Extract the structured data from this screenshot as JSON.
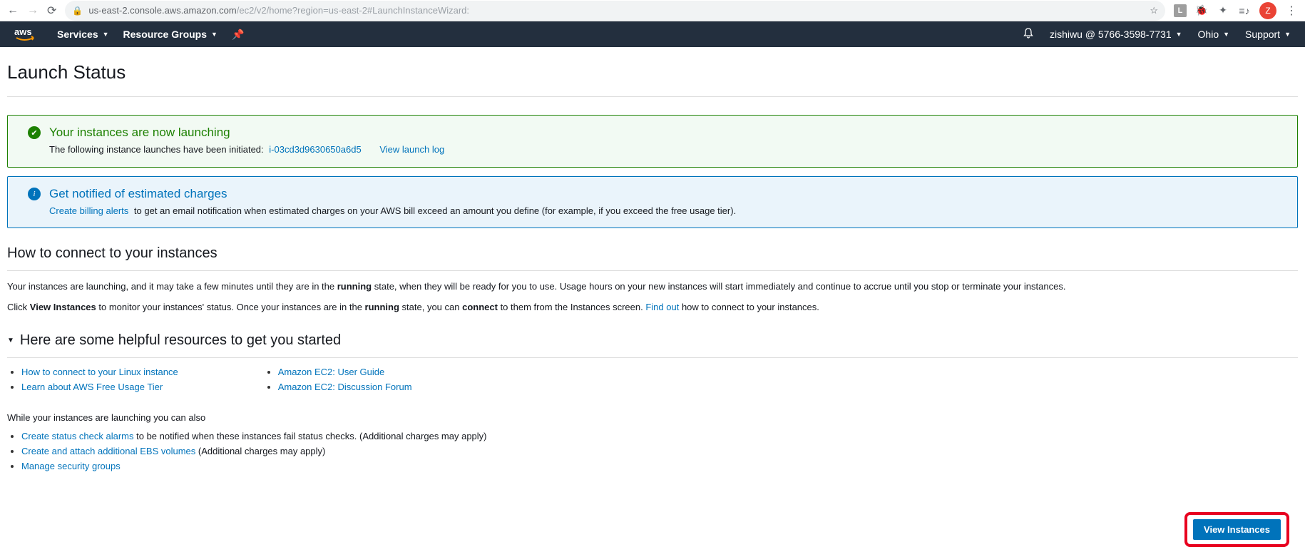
{
  "browser": {
    "url_host": "us-east-2.console.aws.amazon.com",
    "url_path": "/ec2/v2/home?region=us-east-2#LaunchInstanceWizard:",
    "avatar_letter": "Z",
    "ext_l": "L"
  },
  "header": {
    "logo_text": "aws",
    "menu_services": "Services",
    "menu_resource_groups": "Resource Groups",
    "account": "zishiwu @ 5766-3598-7731",
    "region": "Ohio",
    "support": "Support"
  },
  "page": {
    "title": "Launch Status"
  },
  "alert_success": {
    "title": "Your instances are now launching",
    "body_prefix": "The following instance launches have been initiated:",
    "instance_id": "i-03cd3d9630650a6d5",
    "view_log_link": "View launch log"
  },
  "alert_info": {
    "title": "Get notified of estimated charges",
    "link": "Create billing alerts",
    "body": "to get an email notification when estimated charges on your AWS bill exceed an amount you define (for example, if you exceed the free usage tier)."
  },
  "sections": {
    "connect_heading": "How to connect to your instances",
    "para1_a": "Your instances are launching, and it may take a few minutes until they are in the ",
    "para1_b": "running",
    "para1_c": " state, when they will be ready for you to use. Usage hours on your new instances will start immediately and continue to accrue until you stop or terminate your instances.",
    "para2_a": "Click ",
    "para2_b": "View Instances",
    "para2_c": " to monitor your instances' status. Once your instances are in the ",
    "para2_d": "running",
    "para2_e": " state, you can ",
    "para2_f": "connect",
    "para2_g": " to them from the Instances screen. ",
    "para2_link": "Find out",
    "para2_h": " how to connect to your instances.",
    "resources_heading": "Here are some helpful resources to get you started"
  },
  "resource_links": {
    "col1": [
      {
        "text": "How to connect to your Linux instance"
      },
      {
        "text": "Learn about AWS Free Usage Tier"
      }
    ],
    "col2": [
      {
        "text": "Amazon EC2: User Guide"
      },
      {
        "text": "Amazon EC2: Discussion Forum"
      }
    ]
  },
  "while_launching": {
    "intro": "While your instances are launching you can also",
    "items": [
      {
        "link": "Create status check alarms",
        "suffix": " to be notified when these instances fail status checks. (Additional charges may apply)"
      },
      {
        "link": "Create and attach additional EBS volumes",
        "suffix": "  (Additional charges may apply)"
      },
      {
        "link": "Manage security groups",
        "suffix": ""
      }
    ]
  },
  "bottom": {
    "view_instances": "View Instances"
  }
}
